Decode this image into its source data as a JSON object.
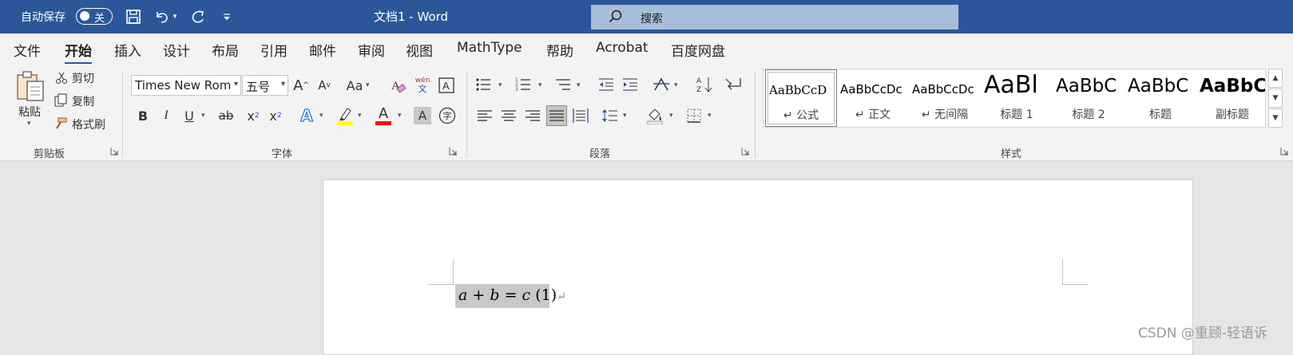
{
  "titlebar": {
    "autosave_label": "自动保存",
    "autosave_state": "关",
    "doc_title": "文档1  -  Word",
    "search_placeholder": "搜索",
    "icons": [
      "save-icon",
      "undo-icon",
      "redo-icon",
      "customize-qat-icon"
    ]
  },
  "menu": {
    "tabs": [
      "文件",
      "开始",
      "插入",
      "设计",
      "布局",
      "引用",
      "邮件",
      "审阅",
      "视图",
      "MathType",
      "帮助",
      "Acrobat",
      "百度网盘"
    ],
    "active": "开始"
  },
  "clipboard": {
    "paste": "粘贴",
    "cut": "剪切",
    "copy": "复制",
    "format_painter": "格式刷",
    "group_label": "剪贴板"
  },
  "font": {
    "font_name": "Times New Rom",
    "font_size": "五号",
    "grow": "A",
    "shrink": "A",
    "change_case": "Aa",
    "phonetic_top": "wén",
    "phonetic_bottom": "文",
    "bold": "B",
    "italic": "I",
    "underline": "U",
    "strike": "ab",
    "subscript": "x",
    "subscript_mark": "2",
    "superscript": "x",
    "superscript_mark": "2",
    "effects": "A",
    "font_color": "A",
    "shading": "A",
    "enclose": "字",
    "group_label": "字体",
    "highlight_color": "#ffff00",
    "font_color_value": "#ff0000"
  },
  "paragraph": {
    "group_label": "段落"
  },
  "styles": {
    "items": [
      {
        "preview": "AaBbCcD",
        "name": "↵ 公式"
      },
      {
        "preview": "AaBbCcDc",
        "name": "↵ 正文"
      },
      {
        "preview": "AaBbCcDc",
        "name": "↵ 无间隔"
      },
      {
        "preview": "AaBl",
        "name": "标题 1"
      },
      {
        "preview": "AaBbC",
        "name": "标题 2"
      },
      {
        "preview": "AaBbC",
        "name": "标题"
      },
      {
        "preview": "AaBbC",
        "name": "副标题"
      }
    ],
    "group_label": "样式"
  },
  "document": {
    "equation_a": "a",
    "equation_plus": "+",
    "equation_b": "b",
    "equation_eq": "=",
    "equation_c": "c",
    "equation_number": "(1)",
    "para_mark": "↵"
  },
  "watermark": "CSDN @重顾-轻语诉",
  "colors": {
    "titlebar": "#2b579a",
    "ribbon": "#f3f3f3",
    "canvas": "#e6e6e6"
  }
}
